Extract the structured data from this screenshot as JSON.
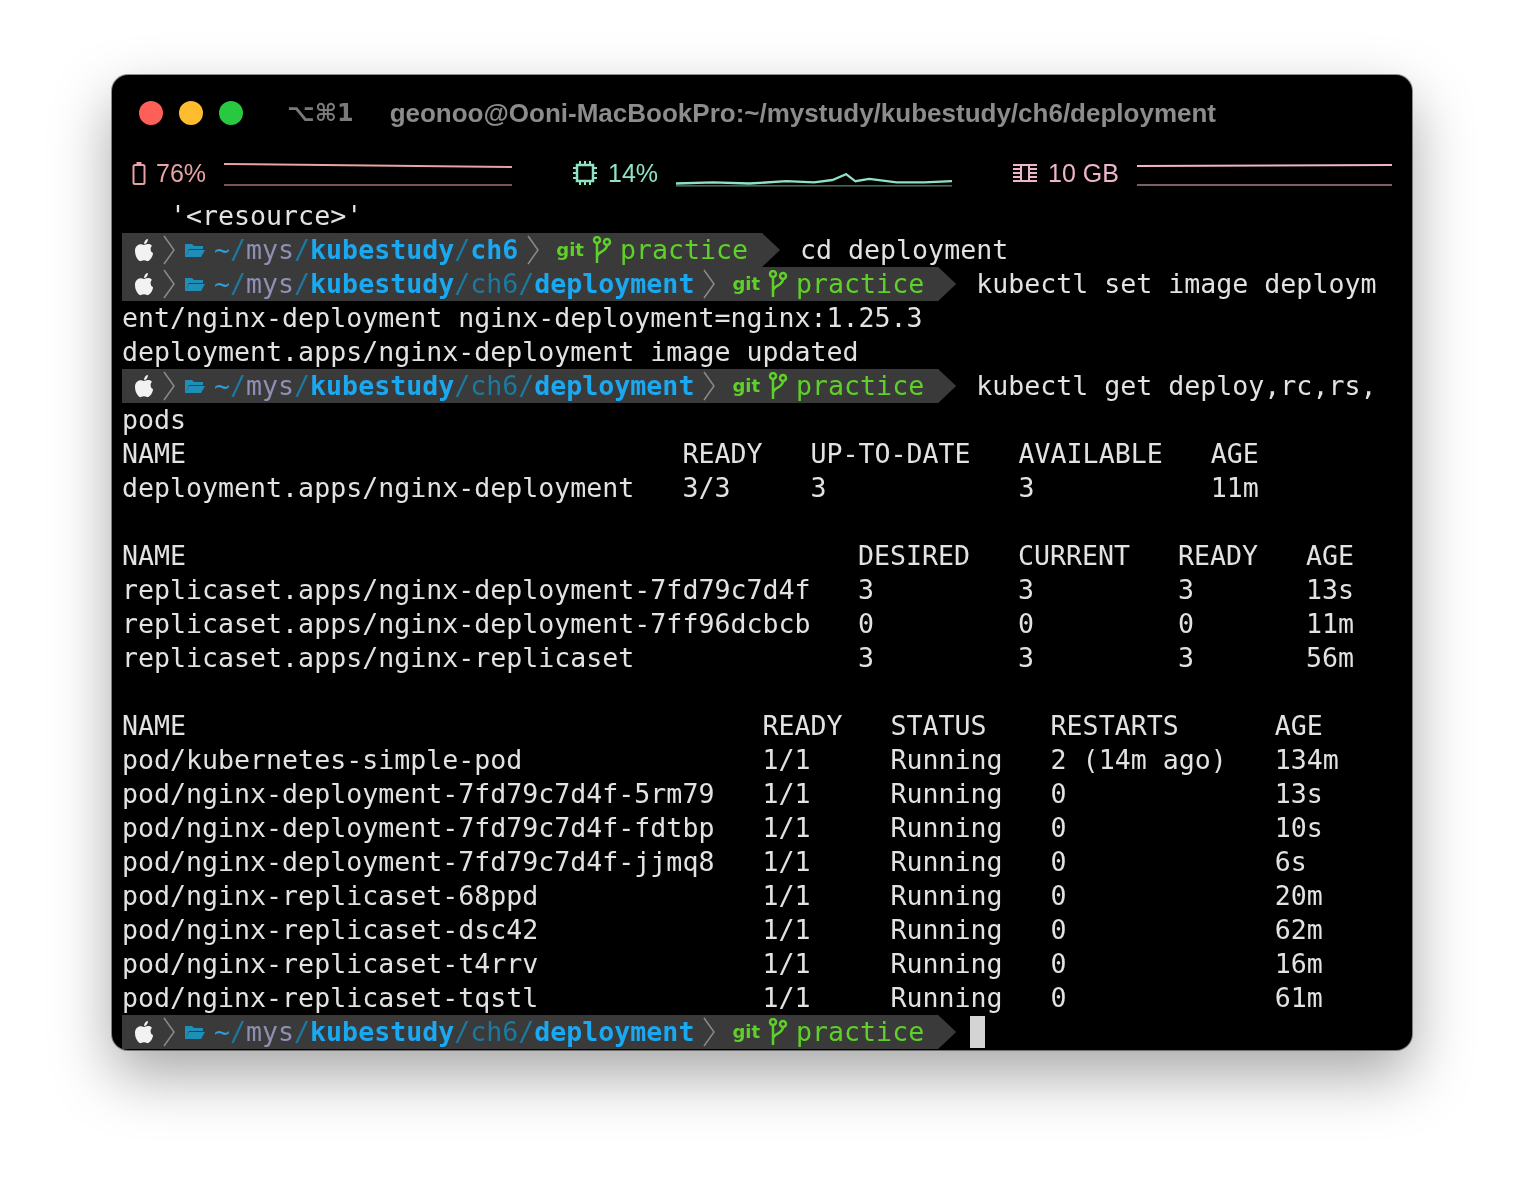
{
  "window": {
    "shortcut": "⌥⌘1",
    "title": "geonoo@Ooni-MacBookPro:~/mystudy/kubestudy/ch6/deployment"
  },
  "status_bar": [
    {
      "kind": "battery",
      "reading": "76%",
      "color": "#e8a3a3"
    },
    {
      "kind": "cpu",
      "reading": "14%",
      "color": "#8fe3c3"
    },
    {
      "kind": "memory",
      "reading": "10 GB",
      "color": "#f0b4cc"
    }
  ],
  "terminal": {
    "lines": [
      {
        "kind": "output",
        "text": "   '<resource>'"
      },
      {
        "kind": "prompt",
        "path": [
          {
            "text": "~",
            "kind": "home"
          },
          {
            "text": "/",
            "kind": "sep"
          },
          {
            "text": "mys",
            "kind": "short"
          },
          {
            "text": "/",
            "kind": "sep"
          },
          {
            "text": "kubestudy",
            "kind": "anchor"
          },
          {
            "text": "/",
            "kind": "sep"
          },
          {
            "text": "ch6",
            "kind": "anchor"
          }
        ],
        "vcs": "git",
        "branch": "practice",
        "command": "cd deployment",
        "cursor": false
      },
      {
        "kind": "prompt",
        "path": [
          {
            "text": "~",
            "kind": "home"
          },
          {
            "text": "/",
            "kind": "sep"
          },
          {
            "text": "mys",
            "kind": "short"
          },
          {
            "text": "/",
            "kind": "sep"
          },
          {
            "text": "kubestudy",
            "kind": "anchor"
          },
          {
            "text": "/",
            "kind": "sep"
          },
          {
            "text": "ch6",
            "kind": "dim"
          },
          {
            "text": "/",
            "kind": "sep"
          },
          {
            "text": "deployment",
            "kind": "anchor"
          }
        ],
        "vcs": "git",
        "branch": "practice",
        "command": "kubectl set image deploym",
        "cursor": false
      },
      {
        "kind": "output",
        "text": "ent/nginx-deployment nginx-deployment=nginx:1.25.3"
      },
      {
        "kind": "output",
        "text": "deployment.apps/nginx-deployment image updated"
      },
      {
        "kind": "prompt",
        "path": [
          {
            "text": "~",
            "kind": "home"
          },
          {
            "text": "/",
            "kind": "sep"
          },
          {
            "text": "mys",
            "kind": "short"
          },
          {
            "text": "/",
            "kind": "sep"
          },
          {
            "text": "kubestudy",
            "kind": "anchor"
          },
          {
            "text": "/",
            "kind": "sep"
          },
          {
            "text": "ch6",
            "kind": "dim"
          },
          {
            "text": "/",
            "kind": "sep"
          },
          {
            "text": "deployment",
            "kind": "anchor"
          }
        ],
        "vcs": "git",
        "branch": "practice",
        "command": "kubectl get deploy,rc,rs,",
        "cursor": false
      },
      {
        "kind": "output",
        "text": "pods"
      },
      {
        "kind": "table",
        "columns": [
          "NAME",
          "READY",
          "UP-TO-DATE",
          "AVAILABLE",
          "AGE"
        ],
        "rows": [
          [
            "deployment.apps/nginx-deployment",
            "3/3",
            "3",
            "3",
            "11m"
          ]
        ]
      },
      {
        "kind": "blank"
      },
      {
        "kind": "table",
        "columns": [
          "NAME",
          "DESIRED",
          "CURRENT",
          "READY",
          "AGE"
        ],
        "rows": [
          [
            "replicaset.apps/nginx-deployment-7fd79c7d4f",
            "3",
            "3",
            "3",
            "13s"
          ],
          [
            "replicaset.apps/nginx-deployment-7ff96dcbcb",
            "0",
            "0",
            "0",
            "11m"
          ],
          [
            "replicaset.apps/nginx-replicaset",
            "3",
            "3",
            "3",
            "56m"
          ]
        ]
      },
      {
        "kind": "blank"
      },
      {
        "kind": "table",
        "columns": [
          "NAME",
          "READY",
          "STATUS",
          "RESTARTS",
          "AGE"
        ],
        "rows": [
          [
            "pod/kubernetes-simple-pod",
            "1/1",
            "Running",
            "2 (14m ago)",
            "134m"
          ],
          [
            "pod/nginx-deployment-7fd79c7d4f-5rm79",
            "1/1",
            "Running",
            "0",
            "13s"
          ],
          [
            "pod/nginx-deployment-7fd79c7d4f-fdtbp",
            "1/1",
            "Running",
            "0",
            "10s"
          ],
          [
            "pod/nginx-deployment-7fd79c7d4f-jjmq8",
            "1/1",
            "Running",
            "0",
            "6s"
          ],
          [
            "pod/nginx-replicaset-68ppd",
            "1/1",
            "Running",
            "0",
            "20m"
          ],
          [
            "pod/nginx-replicaset-dsc42",
            "1/1",
            "Running",
            "0",
            "62m"
          ],
          [
            "pod/nginx-replicaset-t4rrv",
            "1/1",
            "Running",
            "0",
            "16m"
          ],
          [
            "pod/nginx-replicaset-tqstl",
            "1/1",
            "Running",
            "0",
            "61m"
          ]
        ]
      },
      {
        "kind": "prompt",
        "path": [
          {
            "text": "~",
            "kind": "home"
          },
          {
            "text": "/",
            "kind": "sep"
          },
          {
            "text": "mys",
            "kind": "short"
          },
          {
            "text": "/",
            "kind": "sep"
          },
          {
            "text": "kubestudy",
            "kind": "anchor"
          },
          {
            "text": "/",
            "kind": "sep"
          },
          {
            "text": "ch6",
            "kind": "dim"
          },
          {
            "text": "/",
            "kind": "sep"
          },
          {
            "text": "deployment",
            "kind": "anchor"
          }
        ],
        "vcs": "git",
        "branch": "practice",
        "cursor": true
      }
    ]
  }
}
